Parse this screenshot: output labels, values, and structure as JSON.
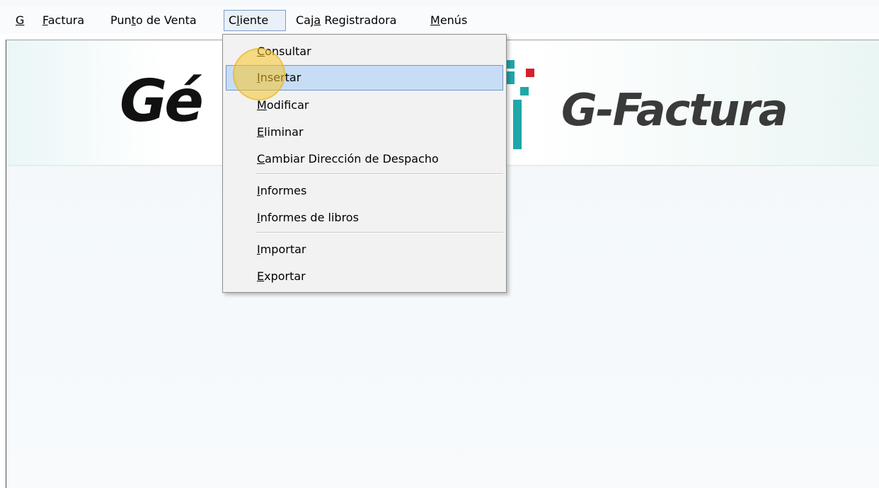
{
  "menubar": {
    "items": [
      {
        "mnemonic": "G",
        "rest": "",
        "pre": ""
      },
      {
        "pre": "",
        "mnemonic": "F",
        "rest": "actura"
      },
      {
        "pre": "Pun",
        "mnemonic": "t",
        "rest": "o de Venta"
      },
      {
        "pre": "C",
        "mnemonic": "l",
        "rest": "iente"
      },
      {
        "pre": "Caj",
        "mnemonic": "a",
        "rest": " Registradora"
      },
      {
        "pre": "",
        "mnemonic": "M",
        "rest": "enús"
      }
    ],
    "active": "Cliente"
  },
  "banner": {
    "left_logo_text": "Gé",
    "right_logo_text": "G-Factura",
    "accent_colors": {
      "teal": "#1fa6a9",
      "red": "#d6202a",
      "dark": "#111111"
    }
  },
  "dropdown": {
    "items": [
      {
        "mnemonic": "C",
        "rest": "onsultar"
      },
      {
        "mnemonic": "I",
        "rest": "nsertar"
      },
      {
        "mnemonic": "M",
        "rest": "odificar"
      },
      {
        "mnemonic": "E",
        "rest": "liminar"
      },
      {
        "mnemonic": "C",
        "rest": "ambiar Dirección de Despacho"
      },
      {
        "mnemonic": "I",
        "rest": "nformes"
      },
      {
        "mnemonic": "I",
        "rest": "nformes de libros"
      },
      {
        "mnemonic": "I",
        "rest": "mportar"
      },
      {
        "mnemonic": "E",
        "rest": "xportar"
      }
    ],
    "highlighted": "Insertar"
  }
}
